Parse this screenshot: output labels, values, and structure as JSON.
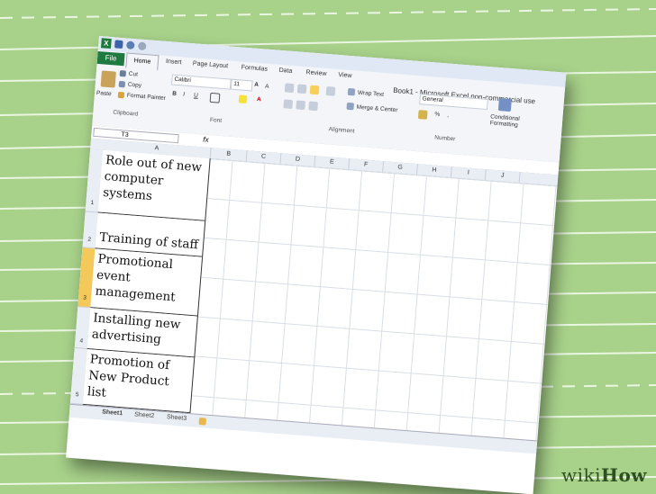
{
  "app": {
    "title": "Book1 - Microsoft Excel non-commercial use",
    "app_icon": "X"
  },
  "tabs": {
    "file": "File",
    "home": "Home",
    "insert": "Insert",
    "page_layout": "Page Layout",
    "formulas": "Formulas",
    "data": "Data",
    "review": "Review",
    "view": "View"
  },
  "clipboard": {
    "paste": "Paste",
    "cut": "Cut",
    "copy": "Copy",
    "format_painter": "Format Painter",
    "label": "Clipboard"
  },
  "font": {
    "name": "Calibri",
    "size": "11",
    "bold": "B",
    "italic": "I",
    "underline": "U",
    "grow": "A",
    "shrink": "A",
    "color_a": "A",
    "label": "Font"
  },
  "alignment": {
    "wrap_text": "Wrap Text",
    "merge_center": "Merge & Center",
    "label": "Alignment"
  },
  "number": {
    "format": "General",
    "percent": "%",
    "comma": ",",
    "label": "Number"
  },
  "styles": {
    "conditional": "Conditional Formatting"
  },
  "formula_bar": {
    "name_box": "T3",
    "fx": "fx"
  },
  "columns": [
    "A",
    "B",
    "C",
    "D",
    "E",
    "F",
    "G",
    "H",
    "I",
    "J"
  ],
  "rows": [
    {
      "num": "1",
      "text": "Role out of new computer systems"
    },
    {
      "num": "2",
      "text": "Training of staff"
    },
    {
      "num": "3",
      "text": "Promotional event management"
    },
    {
      "num": "4",
      "text": "Installing new advertising"
    },
    {
      "num": "5",
      "text": "Promotion of New Product list"
    }
  ],
  "sheets": [
    "Sheet1",
    "Sheet2",
    "Sheet3"
  ],
  "watermark": {
    "wiki": "wiki",
    "how": "How"
  },
  "colors": {
    "background": "#a8d28a",
    "stripe": "#e8f5e0",
    "file_tab": "#1f7a3f",
    "selected_row": "#f5c85a"
  }
}
